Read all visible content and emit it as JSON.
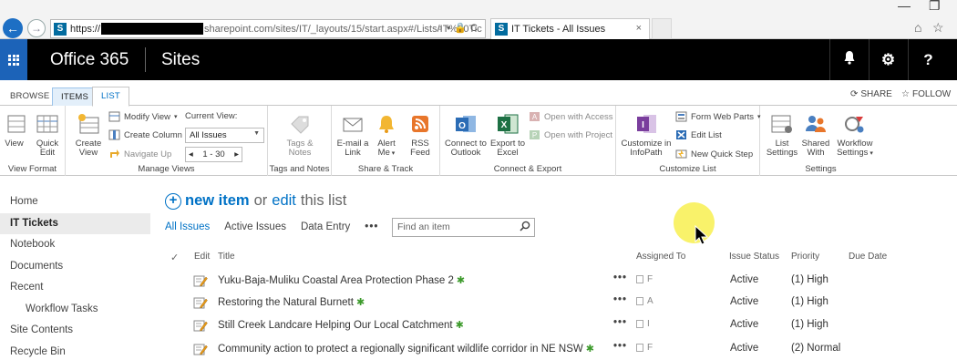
{
  "browser": {
    "url_prefix": "https://",
    "url_suffix": "sharepoint.com/sites/IT/_layouts/15/start.aspx#/Lists/IT%20Tic",
    "tab_title": "IT Tickets - All Issues",
    "tab_close": "×",
    "back_icon": "back-arrow-icon",
    "forward_icon": "forward-arrow-icon",
    "minimize": "—",
    "restore": "❐",
    "home_glyph": "⌂",
    "star_glyph": "☆",
    "address_icons": "⌕▾🔒C"
  },
  "suite": {
    "brand": "Office 365",
    "section": "Sites",
    "bell": "🔔",
    "gear": "⚙",
    "help": "?"
  },
  "ribbon_tabs": {
    "browse": "BROWSE",
    "items": "ITEMS",
    "list": "LIST",
    "share": "SHARE",
    "follow": "FOLLOW"
  },
  "ribbon": {
    "view_format": {
      "label": "View Format",
      "view": "View",
      "quick_edit_1": "Quick",
      "quick_edit_2": "Edit"
    },
    "manage_views": {
      "label": "Manage Views",
      "create_view_1": "Create",
      "create_view_2": "View",
      "modify_view": "Modify View",
      "create_column": "Create Column",
      "navigate_up": "Navigate Up",
      "current_view_label": "Current View:",
      "current_view_value": "All Issues",
      "pager": "1 - 30",
      "pager_prev": "◂",
      "pager_next": "▸"
    },
    "tags_notes": {
      "label": "Tags and Notes",
      "btn_1": "Tags &",
      "btn_2": "Notes"
    },
    "share_track": {
      "label": "Share & Track",
      "email_1": "E-mail a",
      "email_2": "Link",
      "alert_1": "Alert",
      "alert_2": "Me",
      "rss_1": "RSS",
      "rss_2": "Feed"
    },
    "connect_export": {
      "label": "Connect & Export",
      "outlook_1": "Connect to",
      "outlook_2": "Outlook",
      "excel_1": "Export to",
      "excel_2": "Excel",
      "open_access": "Open with Access",
      "open_project": "Open with Project"
    },
    "customize_list": {
      "label": "Customize List",
      "infopath_1": "Customize in",
      "infopath_2": "InfoPath",
      "form_web_parts": "Form Web Parts",
      "edit_list": "Edit List",
      "new_quick_step": "New Quick Step"
    },
    "settings": {
      "label": "Settings",
      "list_settings_1": "List",
      "list_settings_2": "Settings",
      "shared_with_1": "Shared",
      "shared_with_2": "With",
      "workflow_1": "Workflow",
      "workflow_2": "Settings"
    }
  },
  "leftnav": [
    {
      "label": "Home"
    },
    {
      "label": "IT Tickets"
    },
    {
      "label": "Notebook"
    },
    {
      "label": "Documents"
    },
    {
      "label": "Recent"
    },
    {
      "label": "Workflow Tasks"
    },
    {
      "label": "Site Contents"
    },
    {
      "label": "Recycle Bin"
    }
  ],
  "main": {
    "plus": "+",
    "new_item": "new item",
    "or": "or",
    "edit": "edit",
    "this_list": "this list",
    "views": [
      "All Issues",
      "Active Issues",
      "Data Entry"
    ],
    "more": "•••",
    "search_placeholder": "Find an item",
    "columns": {
      "check": "✓",
      "edit": "Edit",
      "title": "Title",
      "assigned_to": "Assigned To",
      "issue_status": "Issue Status",
      "priority": "Priority",
      "due_date": "Due Date"
    },
    "rows": [
      {
        "title": "Yuku-Baja-Muliku Coastal Area Protection Phase 2",
        "new": "✱",
        "assigned": "F",
        "status": "Active",
        "priority": "(1) High"
      },
      {
        "title": "Restoring the Natural Burnett",
        "new": "✱",
        "assigned": "A",
        "status": "Active",
        "priority": "(1) High"
      },
      {
        "title": "Still Creek Landcare Helping Our Local Catchment",
        "new": "✱",
        "assigned": "I",
        "status": "Active",
        "priority": "(1) High"
      },
      {
        "title": "Community action to protect a regionally significant wildlife corridor in NE NSW",
        "new": "✱",
        "assigned": "F",
        "status": "Active",
        "priority": "(2) Normal"
      }
    ]
  },
  "colors": {
    "accent": "#0072c6",
    "suite_bar": "#000000",
    "waffle": "#1c63b8",
    "new_badge": "#3c9a2b"
  }
}
